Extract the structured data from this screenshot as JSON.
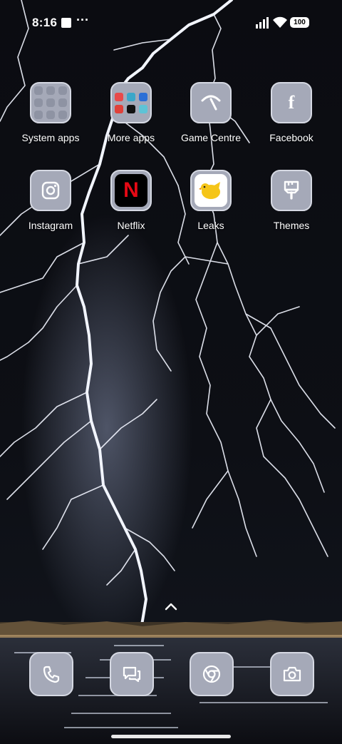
{
  "status_bar": {
    "time": "8:16",
    "more_indicator": "···",
    "battery_level": "100",
    "icons": [
      "notification-square-icon",
      "signal-icon",
      "wifi-icon",
      "battery-icon"
    ]
  },
  "home": {
    "apps": [
      {
        "label": "System apps",
        "icon": "folder-icon"
      },
      {
        "label": "More apps",
        "icon": "folder-icon"
      },
      {
        "label": "Game Centre",
        "icon": "game-centre-icon"
      },
      {
        "label": "Facebook",
        "icon": "facebook-icon"
      },
      {
        "label": "Instagram",
        "icon": "instagram-icon"
      },
      {
        "label": "Netflix",
        "icon": "netflix-icon"
      },
      {
        "label": "Leaks",
        "icon": "leaks-icon"
      },
      {
        "label": "Themes",
        "icon": "brush-icon"
      }
    ],
    "netflix_letter": "N"
  },
  "dock": {
    "apps": [
      {
        "icon": "phone-icon"
      },
      {
        "icon": "messages-icon"
      },
      {
        "icon": "chrome-icon"
      },
      {
        "icon": "camera-icon"
      }
    ]
  },
  "colors": {
    "tile": "#a5a9b8",
    "tile_border": "#d6d9e3",
    "background": "#08090d",
    "netflix_red": "#e50914",
    "leaks_yellow": "#f5c518"
  }
}
